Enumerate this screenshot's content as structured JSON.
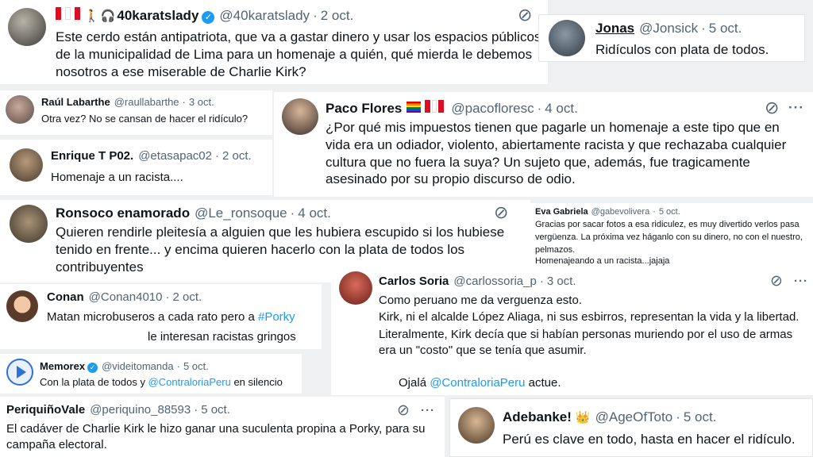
{
  "tweets": {
    "karats": {
      "name": "40karatslady",
      "handle": "@40karatslady",
      "date": "2 oct.",
      "text": "Este cerdo están antipatriota, que va a gastar dinero y usar los espacios públicos de la municipalidad de Lima para un homenaje a quién, qué mierda le debemos nosotros a ese miserable de Charlie Kirk?"
    },
    "jonas": {
      "name": "Jonas",
      "handle": "@Jonsick",
      "date": "5 oct.",
      "text": "Ridículos con plata de todos."
    },
    "raul": {
      "name": "Raúl Labarthe",
      "handle": "@raullabarthe",
      "date": "3 oct.",
      "text": "Otra vez? No se cansan de hacer el ridículo?"
    },
    "paco": {
      "name": "Paco Flores",
      "handle": "@pacofloresc",
      "date": "4 oct.",
      "text": "¿Por qué mis impuestos tienen que pagarle un homenaje a este tipo que en vida era un odiador, violento, abiertamente racista y que rechazaba cualquier cultura que no fuera la suya? Un sujeto que, además, fue tragicamente asesinado por su propio discurso de odio."
    },
    "enrique": {
      "name": "Enrique T P02.",
      "handle": "@etasapac02",
      "date": "2 oct.",
      "text": "Homenaje a un racista...."
    },
    "ronsoco": {
      "name": "Ronsoco enamorado",
      "handle": "@Le_ronsoque",
      "date": "4 oct.",
      "text": "Quieren rendirle pleitesía a alguien que les hubiera escupido si los hubiese tenido en frente... y encima quieren hacerlo con la plata de todos los contribuyentes"
    },
    "eva": {
      "name": "Eva Gabriela",
      "handle": "@gabevolivera",
      "date": "5 oct.",
      "text": "Gracias por sacar fotos a esa ridiculez, es muy divertido verlos pasa vergüenza. La próxima vez háganlo con su dinero, no con el nuestro, pelmazos.",
      "text2": "Homenajeando a un racista...jajaja"
    },
    "conan": {
      "name": "Conan",
      "handle": "@Conan4010",
      "date": "2 oct.",
      "text_before": "Matan microbuseros a cada rato pero a ",
      "mention": "#Porky",
      "text_after": "le interesan racistas gringos"
    },
    "carlos": {
      "name": "Carlos Soria",
      "handle": "@carlossoria_p",
      "date": "3 oct.",
      "p1": "Como peruano me da verguenza esto.",
      "p2": "Kirk, ni el alcalde López Aliaga, ni sus esbirros, representan la vida y la libertad.",
      "p3": "Literalmente, Kirk decía que si habían personas muriendo por el uso de armas era un \"costo\" que se tenía que asumir.",
      "p4_before": "Ojalá ",
      "p4_mention": "@ContraloriaPeru",
      "p4_after": " actue."
    },
    "memorex": {
      "name": "Memorex",
      "handle": "@videitomanda",
      "date": "5 oct.",
      "text_before": "Con la plata de todos y ",
      "mention": "@ContraloriaPeru",
      "text_after": " en silencio"
    },
    "periquino": {
      "name": "PeriquiñoVale",
      "handle": "@periquino_88593",
      "date": "5 oct.",
      "text": "El cadáver de Charlie Kirk le hizo ganar una suculenta propina a Porky,  para su campaña electoral."
    },
    "adebanke": {
      "name": "Adebanke!",
      "handle": "@AgeOfToto",
      "date": "5 oct.",
      "text": "Perú es clave en todo, hasta en hacer el ridículo."
    }
  },
  "icons": {
    "grok": "⊘",
    "more": "···",
    "verified": "✓",
    "crown": "👑",
    "headphones": "🎧",
    "walker": "🚶"
  },
  "colors": {
    "link": "#1d9bf0",
    "secondary": "#536471",
    "text": "#0f1419",
    "verified": "#1d9bf0"
  }
}
